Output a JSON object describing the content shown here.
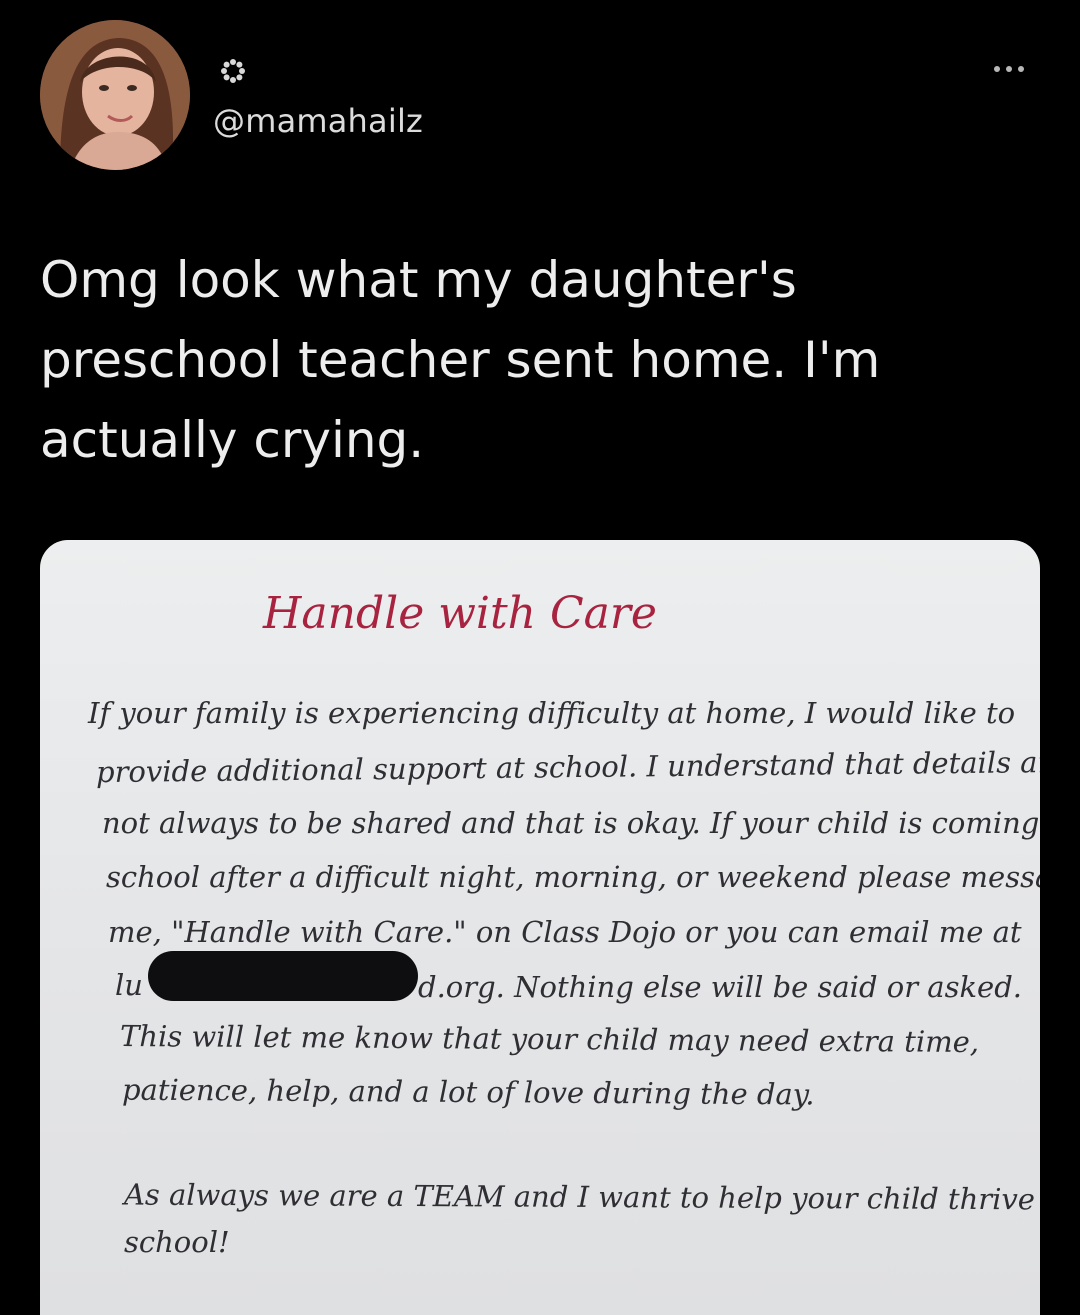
{
  "post": {
    "handle": "@mamahailz",
    "text": "Omg look what my daughter's\npreschool teacher sent home. I'm\nactually crying."
  },
  "icons": {
    "avatar": "user-avatar-photo",
    "settings": "gear-icon",
    "more": "more-options-icon"
  },
  "note": {
    "title": "Handle with Care",
    "lines": [
      "If your family is experiencing difficulty at home, I would like to",
      "provide additional support at school. I understand that details are",
      "not always to be shared and that is okay. If your child is coming to",
      "school after a difficult night, morning, or weekend please message",
      "me, \"Handle with Care.\" on Class Dojo or you can email me at",
      "lu",
      "d.org. Nothing else will be said or asked.",
      "This will let me know that your child may need extra time,",
      "patience, help, and a lot of love during the day.",
      "As always we are a TEAM and I want to help your child thrive in",
      "school!"
    ]
  },
  "colors": {
    "background": "#000000",
    "text": "#ededed",
    "note_title": "#a8233f",
    "note_text": "#2e2e33",
    "note_paper": "#e6e7e9"
  }
}
